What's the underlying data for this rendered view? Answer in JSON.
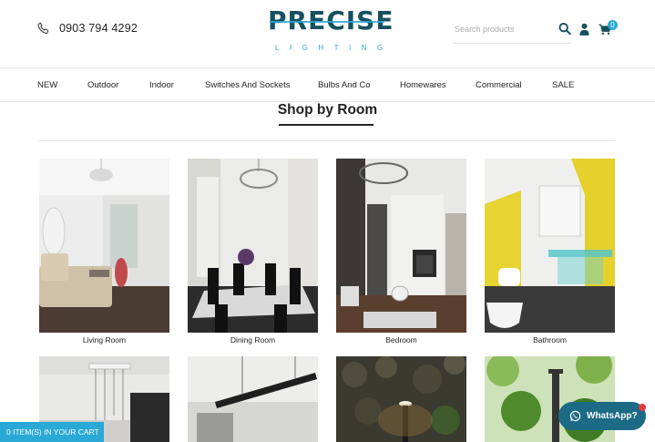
{
  "header": {
    "phone": "0903 794 4292",
    "logo_main": "PRECISE",
    "logo_sub": "LIGHTING",
    "search_placeholder": "Search products",
    "cart_count": "0"
  },
  "nav": {
    "items": [
      {
        "label": "NEW"
      },
      {
        "label": "Outdoor"
      },
      {
        "label": "Indoor"
      },
      {
        "label": "Switches And Sockets"
      },
      {
        "label": "Bulbs And Co"
      },
      {
        "label": "Homewares"
      },
      {
        "label": "Commercial"
      },
      {
        "label": "SALE"
      }
    ]
  },
  "section": {
    "title": "Shop by Room"
  },
  "rooms": [
    {
      "label": "Living Room"
    },
    {
      "label": "Dining Room"
    },
    {
      "label": "Bedroom"
    },
    {
      "label": "Bathroom"
    }
  ],
  "cart_bar": {
    "label": "0 ITEM(S) IN YOUR CART"
  },
  "whatsapp": {
    "label": "WhatsApp?"
  },
  "colors": {
    "accent": "#2aa8d6",
    "logo": "#17505f",
    "whatsapp": "#1b6a86",
    "notification": "#e23b3b"
  },
  "icons": [
    "phone-icon",
    "search-icon",
    "user-icon",
    "cart-icon",
    "whatsapp-icon"
  ]
}
